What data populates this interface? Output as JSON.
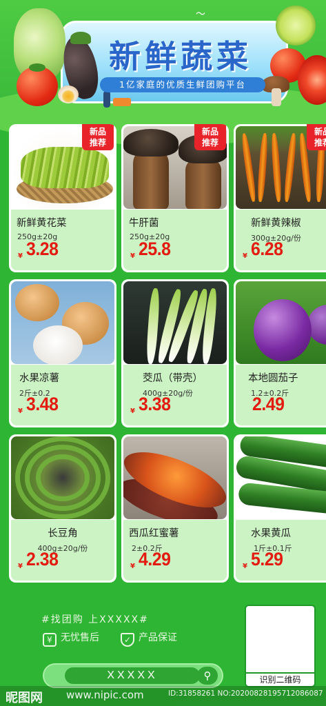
{
  "header": {
    "title": "新鲜蔬菜",
    "subtitle": "1亿家庭的优质生鲜团购平台"
  },
  "badge_label_line1": "新品",
  "badge_label_line2": "推荐",
  "currency_symbol": "¥",
  "products": [
    {
      "name": "新鲜黄花菜",
      "spec": "250g±20g",
      "price": "3.28",
      "badge": true
    },
    {
      "name": "牛肝菌",
      "spec": "250g±20g",
      "price": "25.8",
      "badge": true
    },
    {
      "name": "新鲜黄辣椒",
      "spec": "300g±20g/份",
      "price": "6.28",
      "badge": true
    },
    {
      "name": "水果凉薯",
      "spec": "2斤±0.2",
      "price": "3.48",
      "badge": false
    },
    {
      "name": "茭瓜（带壳）",
      "spec": "400g±20g/份",
      "price": "3.38",
      "badge": false
    },
    {
      "name": "本地圆茄子",
      "spec": "1.2±0.2斤",
      "price": "2.49",
      "badge": false
    },
    {
      "name": "长豆角",
      "spec": "400g±20g/份",
      "price": "2.38",
      "badge": false
    },
    {
      "name": "西瓜红蜜薯",
      "spec": "2±0.2斤",
      "price": "4.29",
      "badge": false
    },
    {
      "name": "水果黄瓜",
      "spec": "1斤±0.1斤",
      "price": "5.29",
      "badge": false
    }
  ],
  "footer": {
    "group_text": "#找团购 上XXXXX#",
    "assurance_1": "无忧售后",
    "assurance_2": "产品保证",
    "assurance_1_icon": "yen-icon",
    "assurance_2_icon": "shield-check-icon",
    "search_value": "XXXXX",
    "qr_label": "识别二维码"
  },
  "watermark": {
    "logo": "昵图网",
    "url": "www.nipic.com",
    "id_text": "ID:31858261 NO:20200828195712086087"
  },
  "colors": {
    "background": "#2db533",
    "price": "#e31b10",
    "badge": "#e8242a",
    "title": "#2a66c9",
    "info_panel": "#ccf3c3"
  }
}
